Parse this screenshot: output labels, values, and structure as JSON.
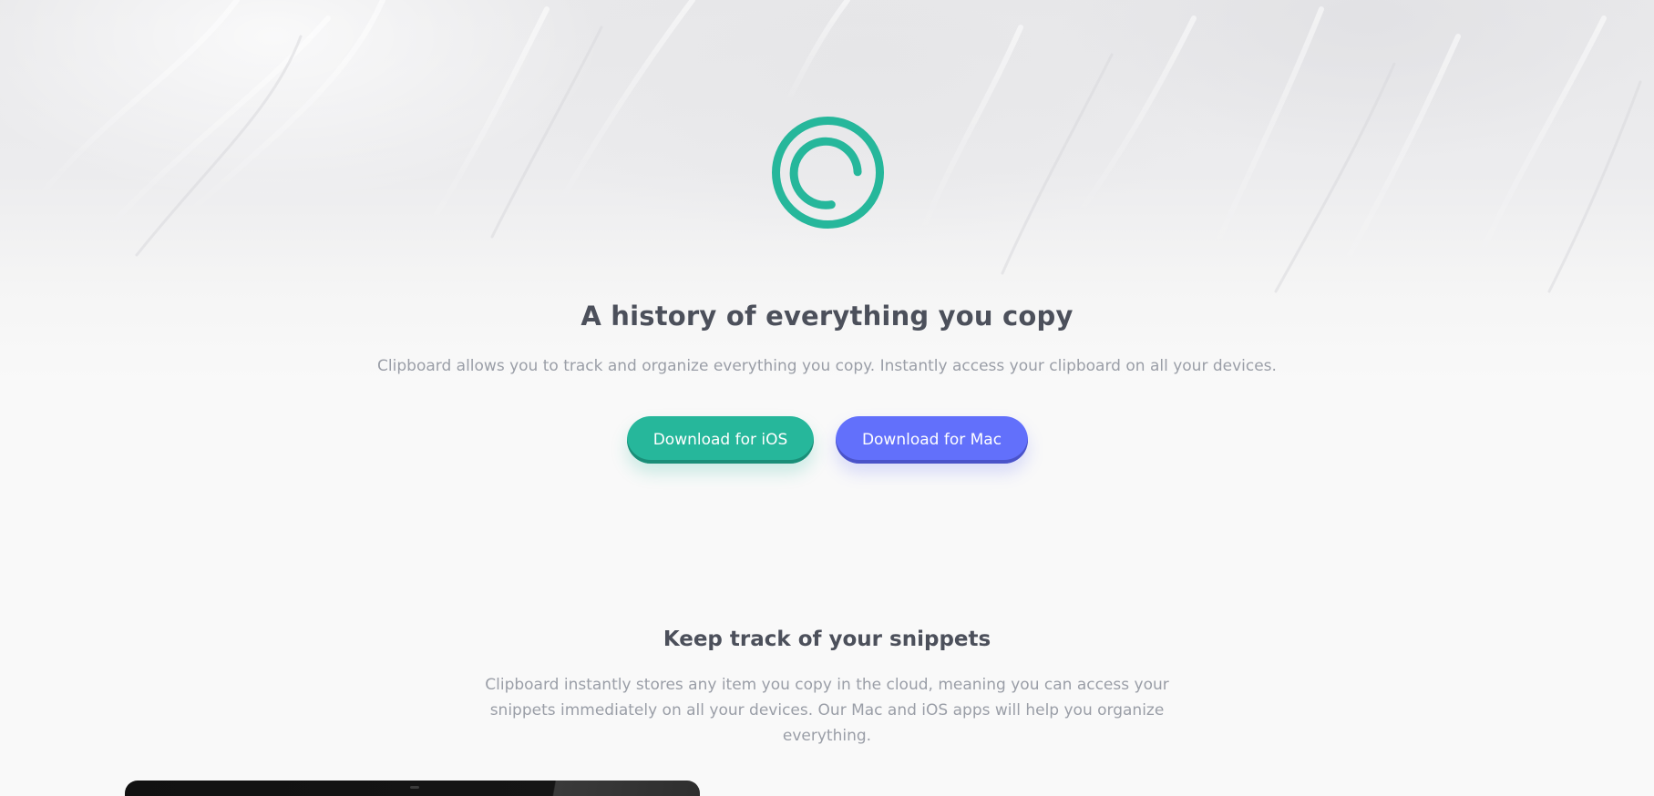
{
  "hero": {
    "logo_icon": "copyright-c-icon",
    "title": "A history of everything you copy",
    "subtitle": "Clipboard allows you to track and organize everything you copy. Instantly access your clipboard on all your devices.",
    "buttons": {
      "ios_label": "Download for iOS",
      "mac_label": "Download for Mac"
    }
  },
  "snippets": {
    "title": "Keep track of your snippets",
    "text": "Clipboard instantly stores any item you copy in the cloud, meaning you can access your snippets immediately on all your devices. Our Mac and iOS apps will help you organize everything."
  },
  "colors": {
    "accent_green": "#26b79b",
    "accent_blue": "#6270fb",
    "heading": "#4c505b",
    "body_text": "#9a9ea7",
    "background": "#f9f9f9"
  }
}
